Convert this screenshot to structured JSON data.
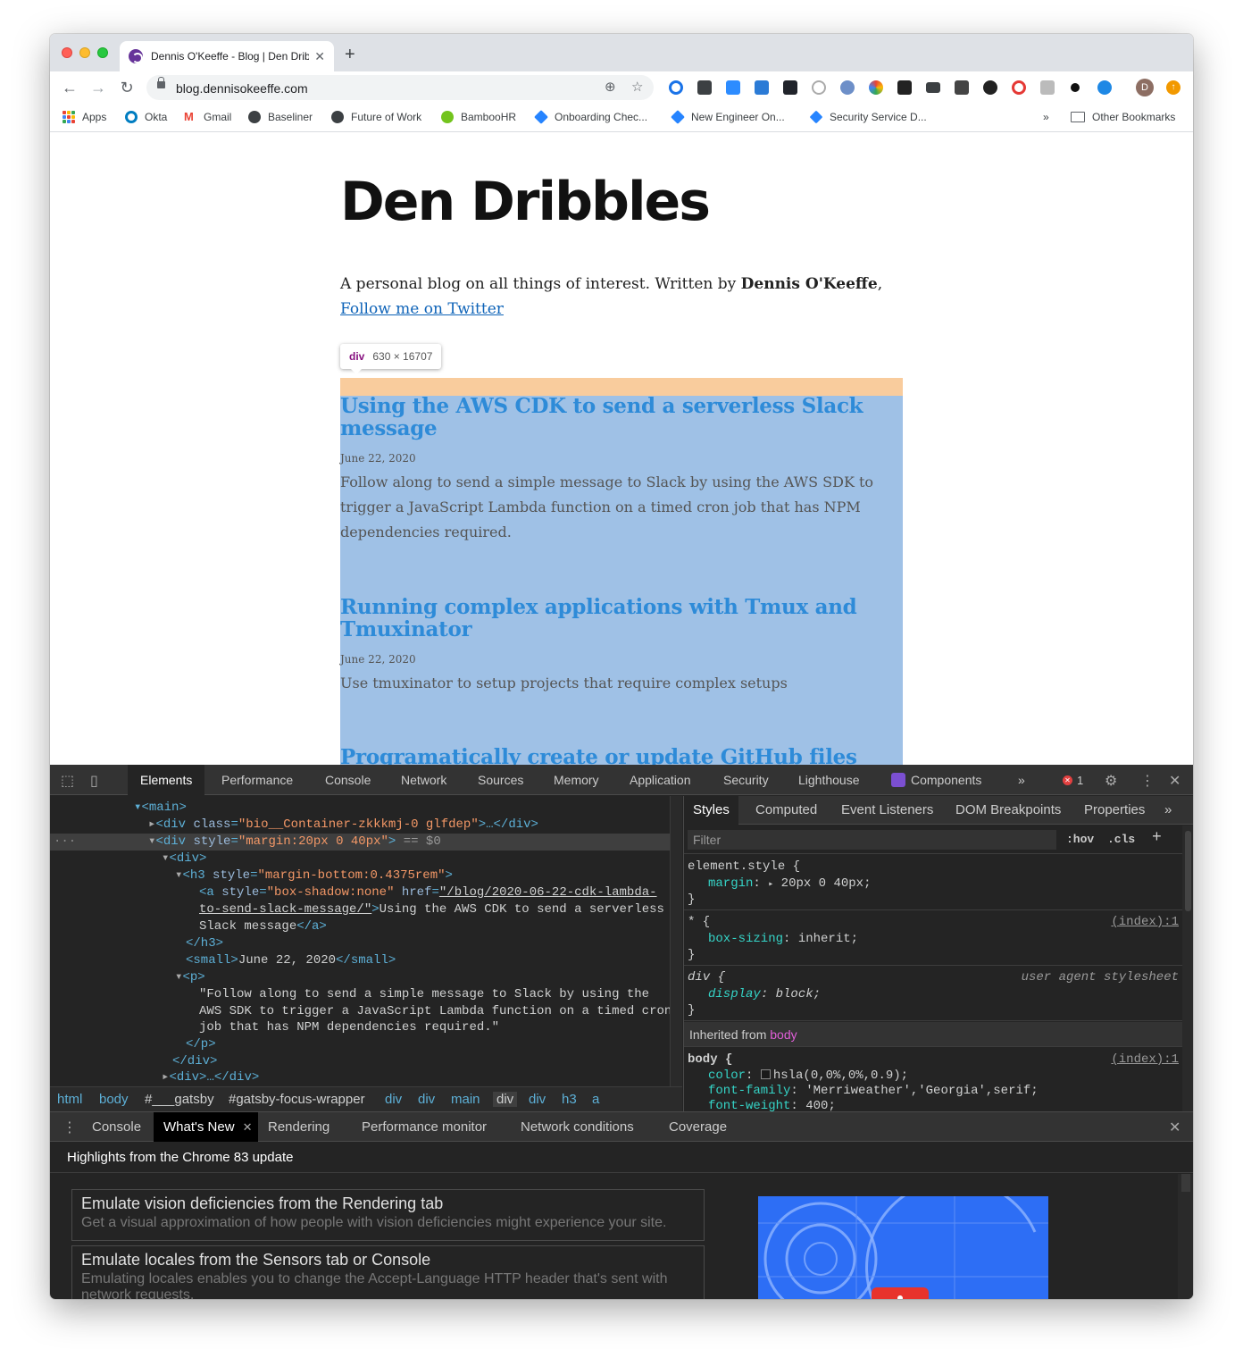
{
  "browser": {
    "tab_title": "Dennis O'Keeffe - Blog | Den Dribbles",
    "url": "blog.dennisokeeffe.com",
    "avatar_letter": "D",
    "bookmarks": [
      {
        "label": "Apps",
        "icon": "apps-grid-icon"
      },
      {
        "label": "Okta",
        "icon": "okta-icon"
      },
      {
        "label": "Gmail",
        "icon": "gmail-icon"
      },
      {
        "label": "Baseliner",
        "icon": "globe-icon"
      },
      {
        "label": "Future of Work",
        "icon": "globe-icon"
      },
      {
        "label": "BambooHR",
        "icon": "bamboohr-icon"
      },
      {
        "label": "Onboarding Chec...",
        "icon": "confluence-icon"
      },
      {
        "label": "New Engineer On...",
        "icon": "confluence-icon"
      },
      {
        "label": "Security Service D...",
        "icon": "jira-icon"
      }
    ],
    "bookmarks_overflow": "»",
    "other_bookmarks": "Other Bookmarks"
  },
  "page": {
    "blog_title": "Den Dribbles",
    "bio_prefix": "A personal blog on all things of interest. Written by ",
    "bio_author": "Dennis O'Keeffe",
    "bio_sep": ", ",
    "bio_link": "Follow me on Twitter",
    "inspector_tooltip": {
      "tag": "div",
      "dimensions": "630 × 16707"
    },
    "posts": [
      {
        "title": "Using the AWS CDK to send a serverless Slack message",
        "date": "June 22, 2020",
        "excerpt": "Follow along to send a simple message to Slack by using the AWS SDK to trigger a JavaScript Lambda function on a timed cron job that has NPM dependencies required."
      },
      {
        "title": "Running complex applications with Tmux and Tmuxinator",
        "date": "June 22, 2020",
        "excerpt": "Use tmuxinator to setup projects that require complex setups"
      },
      {
        "title": "Programatically create or update GitHub files",
        "date": "",
        "excerpt": ""
      }
    ]
  },
  "devtools": {
    "tabs": [
      "Elements",
      "Performance",
      "Console",
      "Network",
      "Sources",
      "Memory",
      "Application",
      "Security",
      "Lighthouse",
      "Components"
    ],
    "active_tab": "Elements",
    "more_tabs": "»",
    "error_count": "1",
    "elements": {
      "l1_tag": "<main>",
      "l2_open": "<div ",
      "l2_attr": "class",
      "l2_val": "\"bio__Container-zkkkmj-0 glfdep\"",
      "l2_close": ">…</div>",
      "l3_open": "<div ",
      "l3_attr": "style",
      "l3_val": "\"margin:20px 0 40px\"",
      "l3_close": ">",
      "l3_eq": " == $0",
      "l4": "<div>",
      "l5_open": "<h3 ",
      "l5_attr": "style",
      "l5_val": "\"margin-bottom:0.4375rem\"",
      "l5_close": ">",
      "l6_open": "<a ",
      "l6_attr1": "style",
      "l6_val1": "\"box-shadow:none\"",
      "l6_attr2": "href",
      "l6_val2a": "\"/blog/2020-06-22-cdk-lambda-",
      "l7_val2b": "to-send-slack-message/\"",
      "l7_gt": ">",
      "l7_text": "Using the AWS CDK to send a serverless",
      "l8_text": "Slack message",
      "l8_close": "</a>",
      "l9": "</h3>",
      "l10_open": "<small>",
      "l10_text": "June 22, 2020",
      "l10_close": "</small>",
      "l11": "<p>",
      "l12": "\"Follow along to send a simple message to Slack by using the",
      "l13": "AWS SDK to trigger a JavaScript Lambda function on a timed cron",
      "l14": "job that has NPM dependencies required.\"",
      "l15": "</p>",
      "l16": "</div>",
      "l17": "<div>…</div>"
    },
    "breadcrumbs": [
      "html",
      "body",
      "#___gatsby",
      "#gatsby-focus-wrapper",
      "div",
      "div",
      "main",
      "div",
      "div",
      "h3",
      "a"
    ],
    "styles_tabs": [
      "Styles",
      "Computed",
      "Event Listeners",
      "DOM Breakpoints",
      "Properties"
    ],
    "styles_more": "»",
    "filter_placeholder": "Filter",
    "hov": ":hov",
    "cls": ".cls",
    "add_rule": "+",
    "rules": {
      "r1_selector": "element.style {",
      "r1_prop": "margin",
      "r1_val": "20px 0 40px;",
      "r2_selector": "* {",
      "r2_source": "(index):1",
      "r2_prop": "box-sizing",
      "r2_val": "inherit;",
      "r3_selector": "div {",
      "r3_source": "user agent stylesheet",
      "r3_prop": "display",
      "r3_val": "block;",
      "close_brace": "}",
      "inherited_prefix": "Inherited from ",
      "inherited_tag": "body",
      "r4_selector": "body {",
      "r4_source": "(index):1",
      "r4_prop1": "color",
      "r4_val1": "hsla(0,0%,0%,0.9);",
      "r4_prop2": "font-family",
      "r4_val2": "'Merriweather','Georgia',serif;",
      "r4_prop3": "font-weight",
      "r4_val3": "400;"
    },
    "drawer_tabs": [
      "Console",
      "What's New",
      "Rendering",
      "Performance monitor",
      "Network conditions",
      "Coverage"
    ],
    "drawer_active": "What's New",
    "whats_new_header": "Highlights from the Chrome 83 update",
    "cards": [
      {
        "title": "Emulate vision deficiencies from the Rendering tab",
        "desc": "Get a visual approximation of how people with vision deficiencies might experience your site."
      },
      {
        "title": "Emulate locales from the Sensors tab or Console",
        "desc": "Emulating locales enables you to change the Accept-Language HTTP header that's sent with network requests."
      }
    ]
  },
  "colors": {
    "highlight_content": "#9fc1e6",
    "highlight_margin": "#f9cc9d",
    "link": "#0e63b8",
    "post_title": "#2e8bd8",
    "devtools_bg": "#242424"
  }
}
